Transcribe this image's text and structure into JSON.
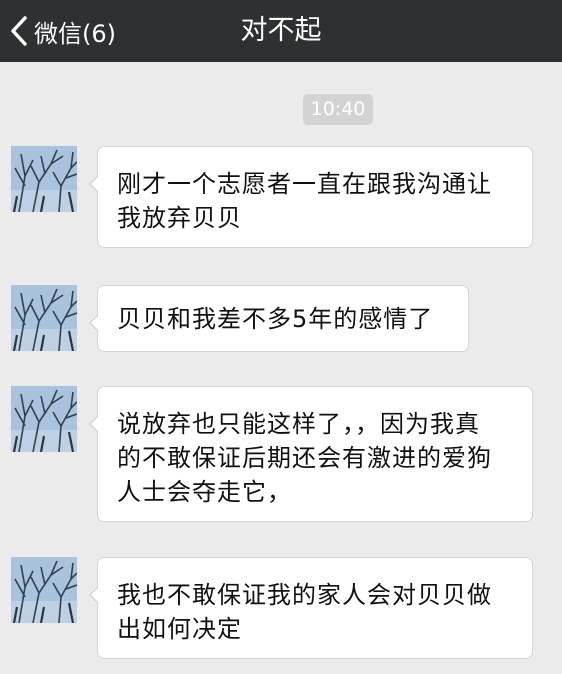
{
  "header": {
    "back_label": "微信(6)",
    "title": "对不起"
  },
  "timestamp": "10:40",
  "messages": [
    {
      "lines": [
        "刚才一个志愿者一直在跟我沟通让",
        "我放弃贝贝"
      ]
    },
    {
      "lines": [
        "贝贝和我差不多5年的感情了"
      ]
    },
    {
      "lines": [
        "说放弃也只能这样了，，因为我真",
        "的不敢保证后期还会有激进的爱狗",
        "人士会夺走它，"
      ]
    },
    {
      "lines": [
        "我也不敢保证我的家人会对贝贝做",
        "出如何决定"
      ]
    }
  ],
  "colors": {
    "nav_bg": "#2e3132",
    "chat_bg": "#ebebeb",
    "bubble_bg": "#ffffff",
    "time_pill_bg": "#d3d3d3"
  },
  "icons": {
    "back": "chevron-left-icon",
    "avatar": "tree-branches-sky-photo"
  }
}
